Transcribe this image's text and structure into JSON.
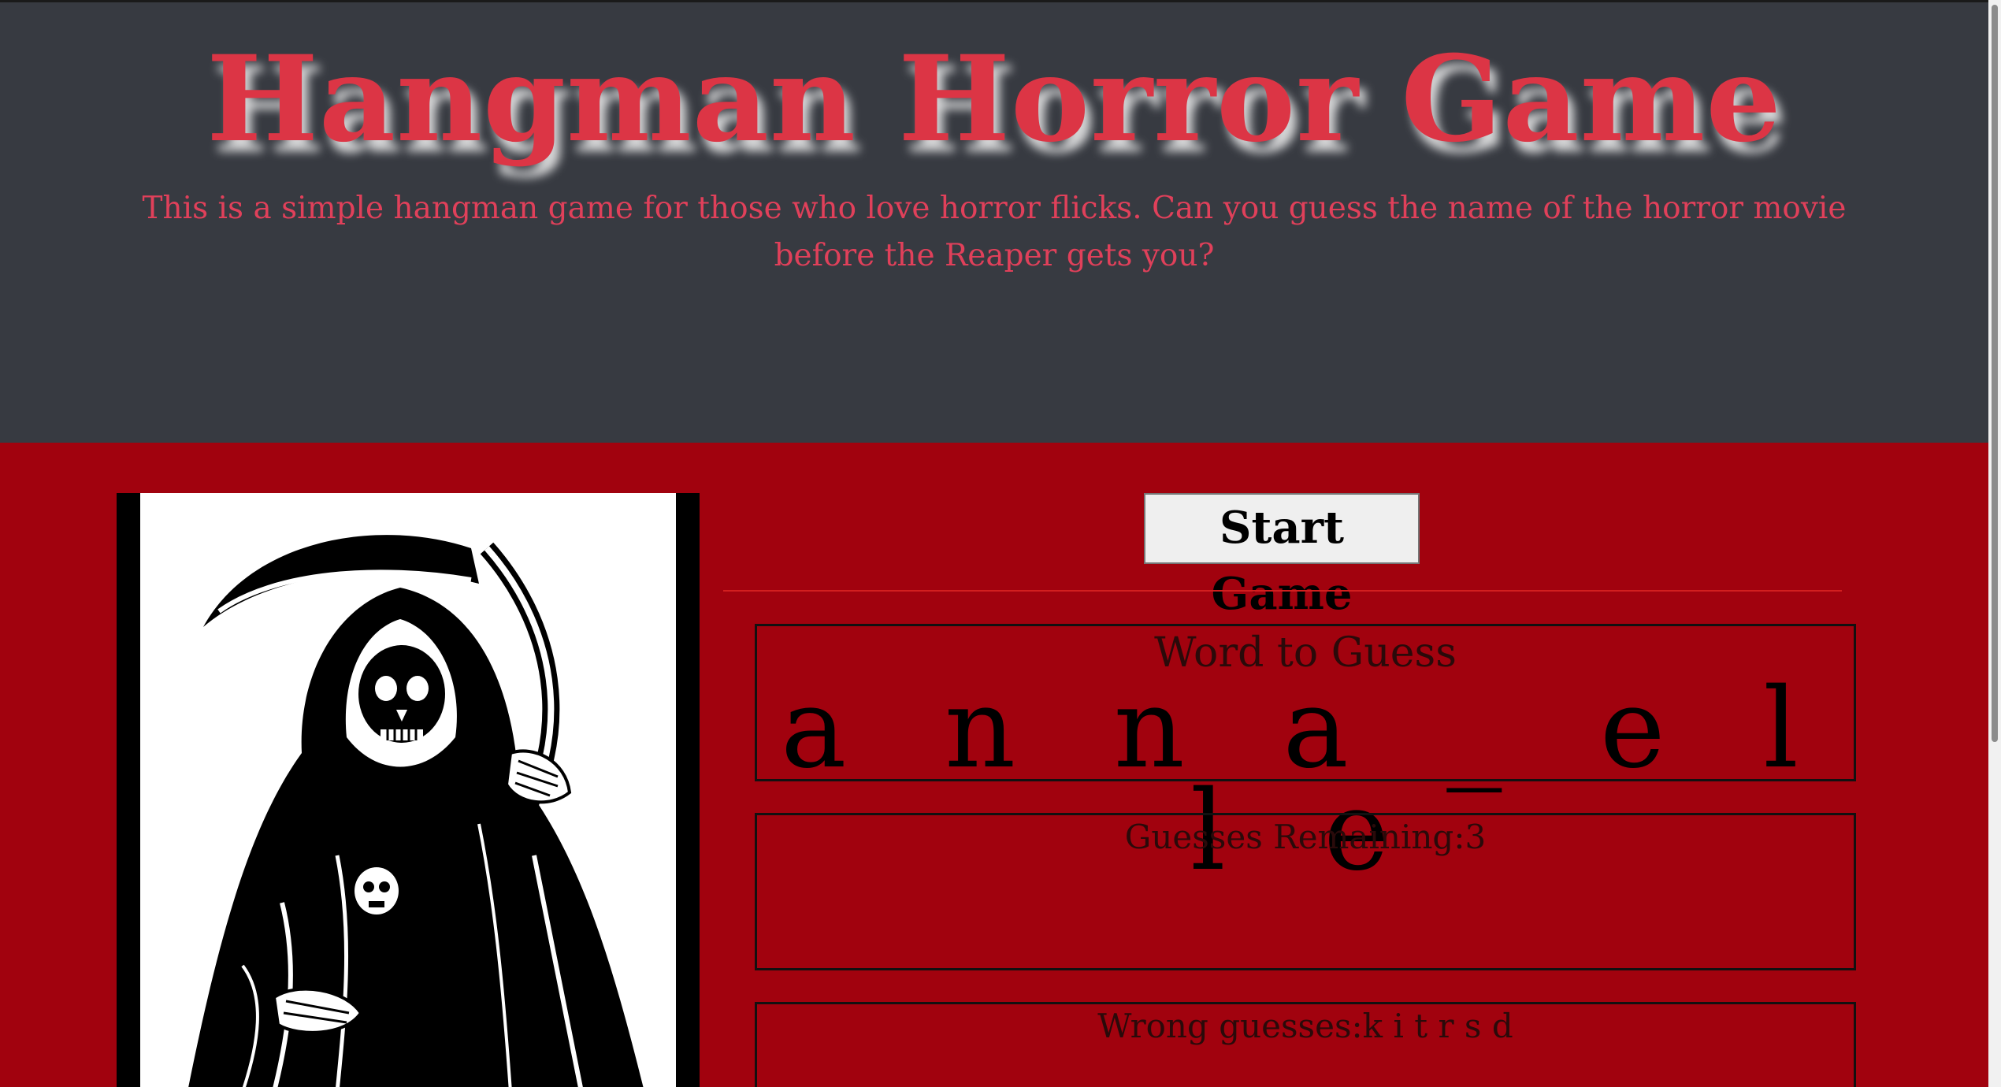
{
  "header": {
    "title": "Hangman Horror Game",
    "subtitle": "This is a simple hangman game for those who love horror flicks. Can you guess the name of the horror movie before the Reaper gets you?"
  },
  "controls": {
    "start_label": "Start Game"
  },
  "game": {
    "word_label": "Word to Guess",
    "word_value": "a n n a _ e l l e",
    "guesses_label": "Guesses Remaining:3",
    "wrong_label": "Wrong guesses:k i t r s d"
  },
  "image": {
    "icon": "grim-reaper-icon"
  },
  "colors": {
    "header_bg": "#373a41",
    "main_bg": "#a1020e",
    "title": "#dc3545"
  }
}
